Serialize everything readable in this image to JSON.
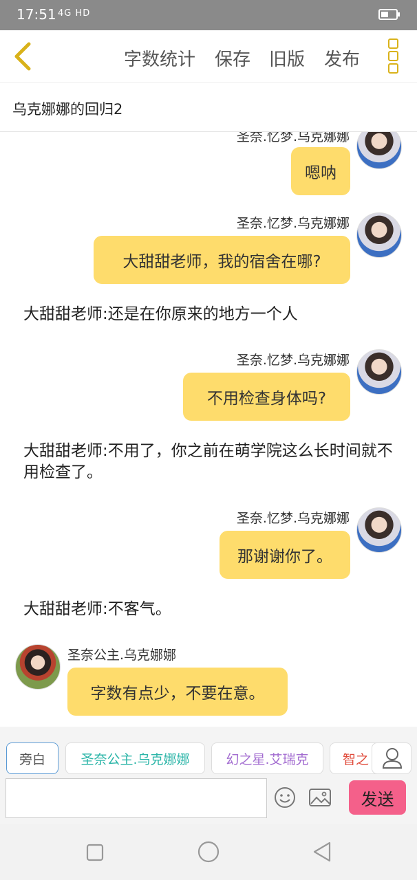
{
  "status": {
    "time": "17:51",
    "signal": "4G HD"
  },
  "nav": {
    "word_count": "字数统计",
    "save": "保存",
    "old_version": "旧版",
    "publish": "发布"
  },
  "title": "乌克娜娜的回归2",
  "messages": {
    "m0": {
      "name": "圣奈.忆梦.乌克娜娜",
      "text": "嗯呐"
    },
    "m1": {
      "name": "圣奈.忆梦.乌克娜娜",
      "text": "大甜甜老师，我的宿舍在哪?"
    },
    "n1": "大甜甜老师:还是在你原来的地方一个人",
    "m2": {
      "name": "圣奈.忆梦.乌克娜娜",
      "text": "不用检查身体吗?"
    },
    "n2": "大甜甜老师:不用了，你之前在萌学院这么长时间就不用检查了。",
    "m3": {
      "name": "圣奈.忆梦.乌克娜娜",
      "text": "那谢谢你了。"
    },
    "n3": "大甜甜老师:不客气。",
    "m4": {
      "name": "圣奈公主.乌克娜娜",
      "text": "字数有点少，不要在意。"
    }
  },
  "roles": {
    "narrator": "旁白",
    "r1": "圣奈公主.乌克娜娜",
    "r2": "幻之星.艾瑞克",
    "r3": "智之"
  },
  "colors": {
    "bubble": "#fedc6c",
    "accent": "#d9b21a",
    "send": "#f4608a",
    "role1": "#2bb5a8",
    "role2": "#a26bd0",
    "role3": "#e04a3a"
  },
  "input": {
    "send": "发送"
  }
}
